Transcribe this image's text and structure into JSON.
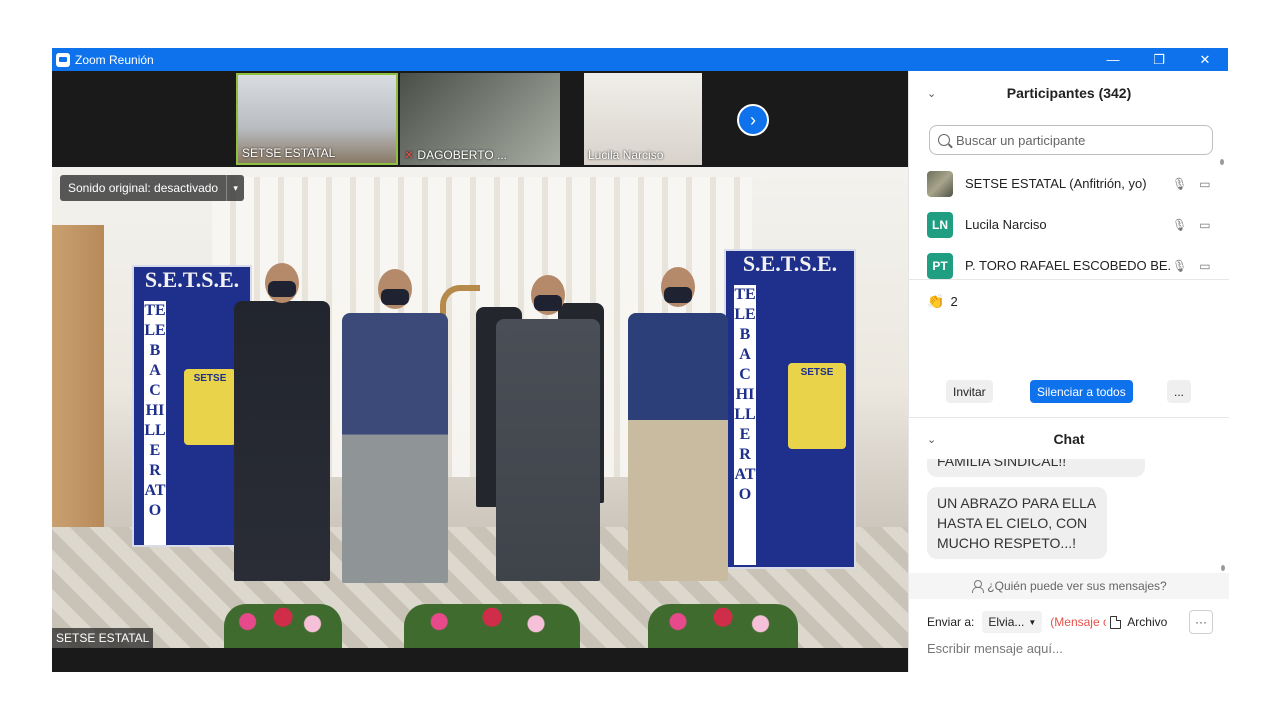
{
  "window": {
    "title": "Zoom Reunión",
    "controls": {
      "minimize": "—",
      "restore": "❐",
      "close": "✕"
    }
  },
  "video": {
    "thumbnails": [
      {
        "name": "SETSE ESTATAL",
        "muted": false
      },
      {
        "name": "DAGOBERTO ...",
        "muted": true
      },
      {
        "name": "Lucila Narciso",
        "muted": false
      }
    ],
    "next_label": "›",
    "sound_button": "Sonido original: desactivado",
    "sound_caret": "▾",
    "main_speaker": "SETSE ESTATAL",
    "banner_header": "S.E.T.S.E.",
    "banner_vertical": "TELEBACHILLERATO",
    "emblem_text": "SETSE"
  },
  "participants": {
    "header": "Participantes (342)",
    "chevron": "⌄",
    "search_placeholder": "Buscar un participante",
    "list": [
      {
        "initials": "",
        "name": "SETSE ESTATAL (Anfitrión, yo)",
        "color": ""
      },
      {
        "initials": "LN",
        "name": "Lucila Narciso",
        "color": "#1f9e82"
      },
      {
        "initials": "PT",
        "name": "P. TORO RAFAEL ESCOBEDO BE...",
        "color": "#1f9e82"
      }
    ],
    "reaction_count": "2",
    "invite_label": "Invitar",
    "mute_all_label": "Silenciar a todos",
    "more_label": "..."
  },
  "chat": {
    "header": "Chat",
    "messages": [
      "FAMILIA SINDICAL!!",
      "UN ABRAZO PARA ELLA HASTA EL CIELO, CON MUCHO RESPETO...!"
    ],
    "who_sees": "¿Quién puede ver sus mensajes?",
    "send_to_label": "Enviar a:",
    "send_to_value": "Elvia...",
    "private_label": "(Mensaje c",
    "file_label": "Archivo",
    "more_label": "···",
    "input_placeholder": "Escribir mensaje aquí..."
  }
}
